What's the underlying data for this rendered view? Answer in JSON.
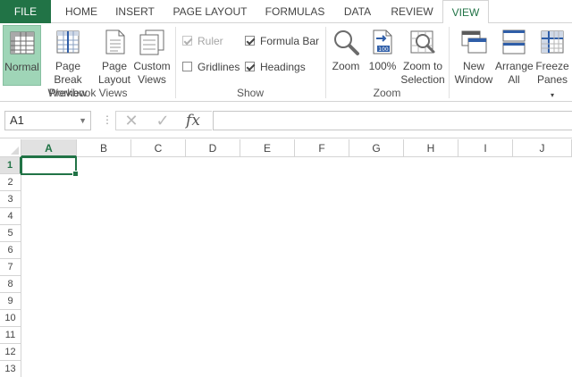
{
  "tabs": [
    {
      "label": "FILE"
    },
    {
      "label": "HOME"
    },
    {
      "label": "INSERT"
    },
    {
      "label": "PAGE LAYOUT"
    },
    {
      "label": "FORMULAS"
    },
    {
      "label": "DATA"
    },
    {
      "label": "REVIEW"
    },
    {
      "label": "VIEW"
    }
  ],
  "active_tab": "VIEW",
  "ribbon": {
    "workbook_views": {
      "label": "Workbook Views",
      "normal": "Normal",
      "page_break_1": "Page Break",
      "page_break_2": "Preview",
      "page_layout_1": "Page",
      "page_layout_2": "Layout",
      "custom_views_1": "Custom",
      "custom_views_2": "Views"
    },
    "show": {
      "label": "Show",
      "ruler": "Ruler",
      "formula_bar": "Formula Bar",
      "gridlines": "Gridlines",
      "headings": "Headings",
      "ruler_checked": true,
      "ruler_disabled": true,
      "formula_bar_checked": true,
      "gridlines_checked": false,
      "headings_checked": true
    },
    "zoom": {
      "label": "Zoom",
      "zoom": "Zoom",
      "hundred": "100%",
      "zoom_to_1": "Zoom to",
      "zoom_to_2": "Selection"
    },
    "window": {
      "new_1": "New",
      "new_2": "Window",
      "arrange_1": "Arrange",
      "arrange_2": "All",
      "freeze_1": "Freeze",
      "freeze_2": "Panes"
    }
  },
  "formula_bar": {
    "name_box": "A1",
    "fx": "fx",
    "value": ""
  },
  "grid": {
    "columns": [
      "A",
      "B",
      "C",
      "D",
      "E",
      "F",
      "G",
      "H",
      "I",
      "J"
    ],
    "rows": [
      "1",
      "2",
      "3",
      "4",
      "5",
      "6",
      "7",
      "8",
      "9",
      "10",
      "11",
      "12",
      "13"
    ],
    "active_cell": "A1"
  },
  "colors": {
    "accent": "#217346",
    "selected_view": "#9fd5b7"
  }
}
